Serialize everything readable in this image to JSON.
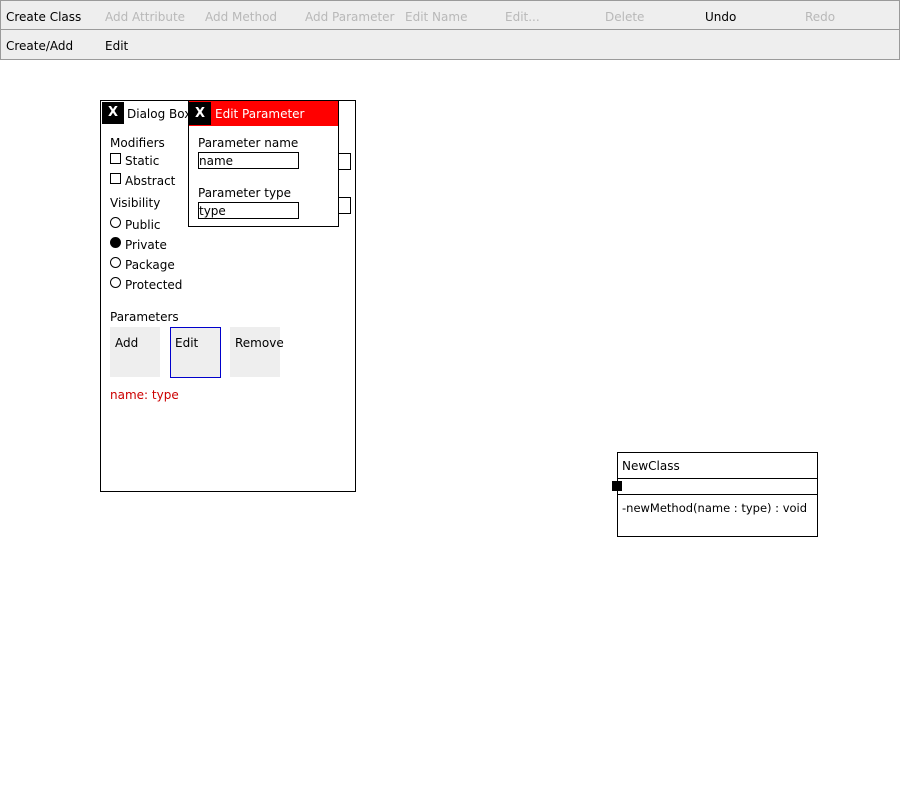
{
  "toolbar": {
    "row1": [
      {
        "label": "Create Class",
        "enabled": true
      },
      {
        "label": "Add Attribute",
        "enabled": false
      },
      {
        "label": "Add Method",
        "enabled": false
      },
      {
        "label": "Add Parameter",
        "enabled": false
      },
      {
        "label": "Edit Name",
        "enabled": false
      },
      {
        "label": "Edit...",
        "enabled": false
      },
      {
        "label": "Delete",
        "enabled": false
      },
      {
        "label": "Undo",
        "enabled": true
      },
      {
        "label": "Redo",
        "enabled": false
      }
    ],
    "row2": [
      {
        "label": "Create/Add"
      },
      {
        "label": "Edit"
      }
    ]
  },
  "dialog": {
    "close_label": "X",
    "title": "Dialog Box",
    "modifiers": {
      "heading": "Modifiers",
      "static_label": "Static",
      "static_checked": false,
      "abstract_label": "Abstract",
      "abstract_checked": false
    },
    "visibility": {
      "heading": "Visibility",
      "options": [
        "Public",
        "Private",
        "Package",
        "Protected"
      ],
      "selected": "Private"
    },
    "parameters": {
      "heading": "Parameters",
      "add_label": "Add",
      "edit_label": "Edit",
      "remove_label": "Remove",
      "items": [
        "name: type"
      ]
    }
  },
  "edit_parameter": {
    "close_label": "X",
    "title": "Edit Parameter",
    "name_label": "Parameter name",
    "name_value": "name",
    "type_label": "Parameter type",
    "type_value": "type"
  },
  "uml_class": {
    "name": "NewClass",
    "methods": [
      "-newMethod(name : type) : void"
    ]
  },
  "colors": {
    "toolbar_bg": "#eeeeee",
    "disabled_text": "#b8b8b8",
    "popup_header": "#ff0000",
    "parameter_text": "#cc0000",
    "focus_border": "#0000cc"
  }
}
